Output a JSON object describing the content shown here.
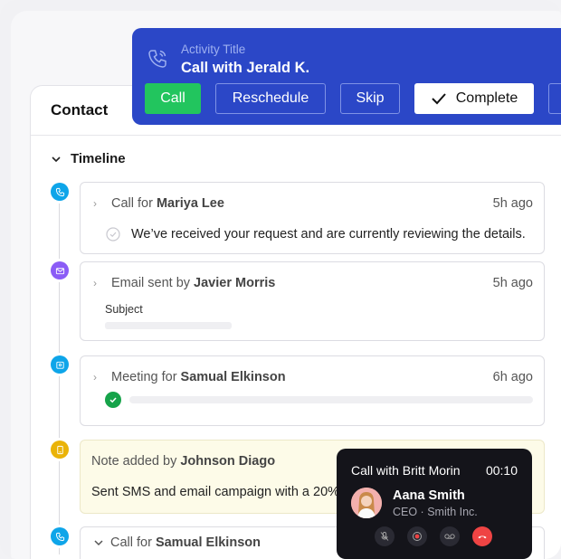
{
  "contact": {
    "title": "Contact"
  },
  "timeline": {
    "heading": "Timeline",
    "items": [
      {
        "prefix": "Call for",
        "who": "Mariya Lee",
        "time": "5h ago",
        "body": "We’ve received your request and are currently reviewing the details.",
        "dot_color": "#0ea5e9",
        "icon": "phone-icon"
      },
      {
        "prefix": "Email sent by",
        "who": "Javier Morris",
        "time": "5h ago",
        "field_label": "Subject",
        "dot_color": "#8b5cf6",
        "icon": "mail-icon"
      },
      {
        "prefix": "Meeting for",
        "who": "Samual Elkinson",
        "time": "6h ago",
        "progress": 1.0,
        "dot_color": "#0ea5e9",
        "icon": "meeting-icon"
      },
      {
        "prefix": "Note added by",
        "who": "Johnson Diago",
        "body": "Sent SMS and email campaign with a 20% o",
        "dot_color": "#eab308",
        "icon": "note-icon"
      },
      {
        "prefix": "Call for",
        "who": "Samual Elkinson",
        "dot_color": "#0ea5e9",
        "icon": "phone-icon"
      }
    ]
  },
  "activity": {
    "label": "Activity Title",
    "title": "Call with Jerald K.",
    "buttons": {
      "call": "Call",
      "reschedule": "Reschedule",
      "skip": "Skip",
      "complete": "Complete"
    }
  },
  "call_widget": {
    "title": "Call with Britt Morin",
    "timer": "00:10",
    "name": "Aana Smith",
    "role": "CEO · Smith Inc."
  },
  "colors": {
    "accent": "#2b47c7",
    "success": "#22c55e",
    "danger": "#ef4444"
  }
}
